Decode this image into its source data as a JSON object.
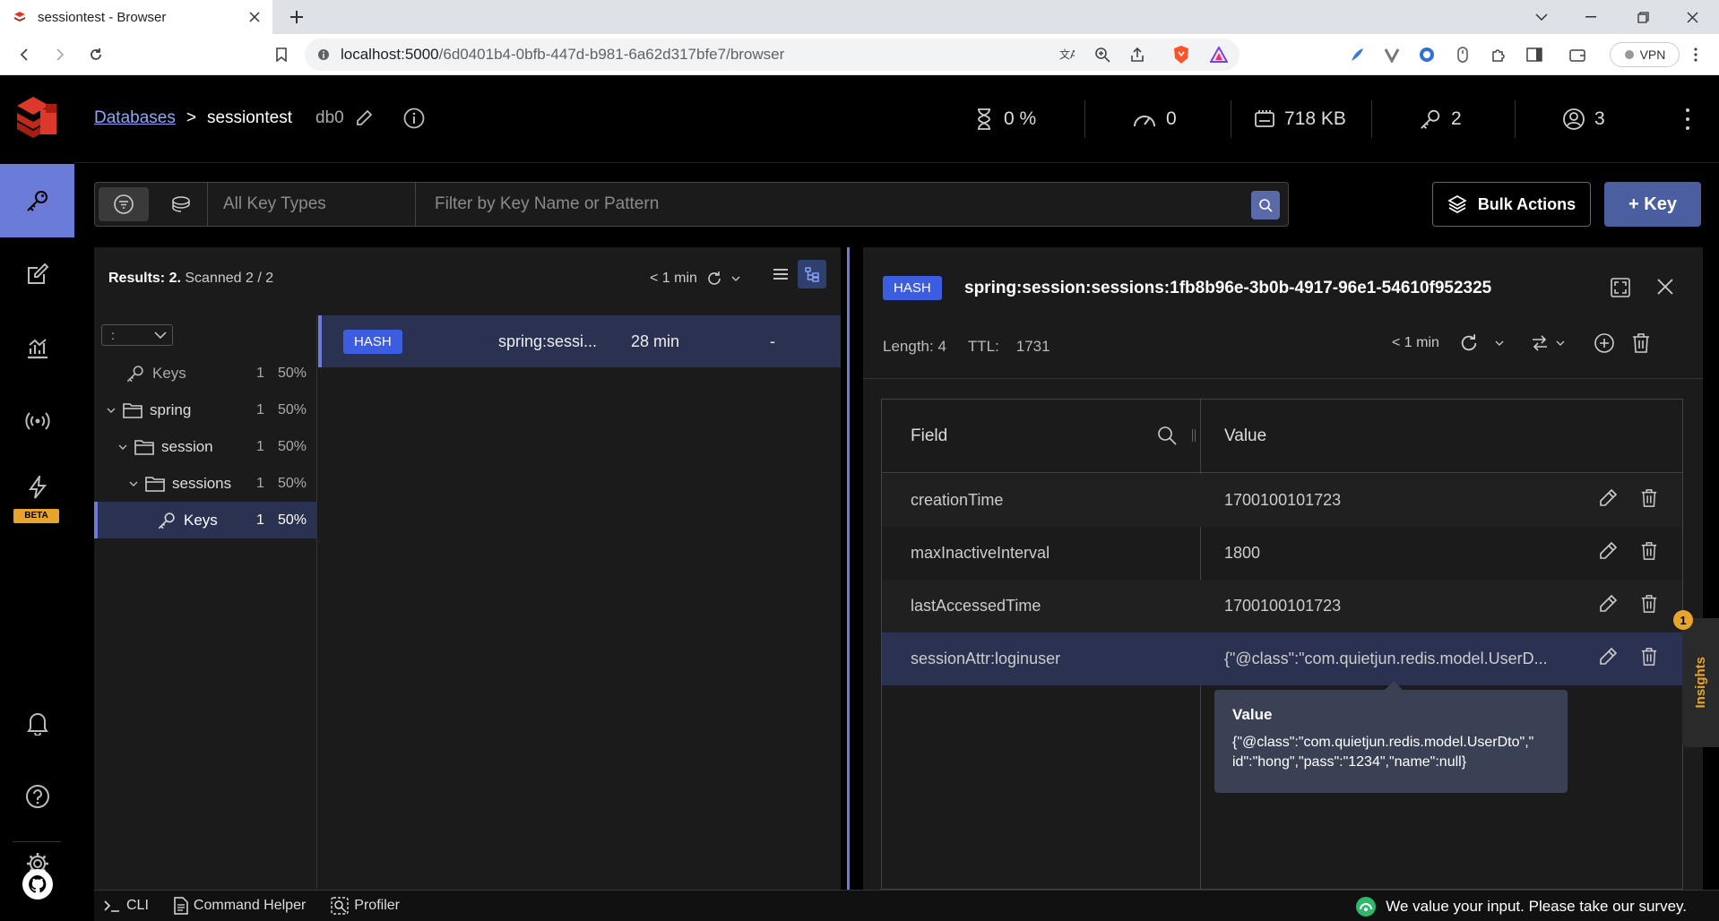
{
  "browser": {
    "tab_title": "sessiontest - Browser",
    "url_host": "localhost:5000",
    "url_path": "/6d0401b4-0bfb-447d-b981-6a62d317bfe7/browser",
    "vpn_label": "VPN"
  },
  "header": {
    "breadcrumb_link": "Databases",
    "breadcrumb_sep": ">",
    "db_name": "sessiontest",
    "db_index": "db0",
    "stats": {
      "cpu": "0 %",
      "ops": "0",
      "memory": "718 KB",
      "keys": "2",
      "clients": "3"
    }
  },
  "filter": {
    "key_type": "All Key Types",
    "placeholder": "Filter by Key Name or Pattern"
  },
  "actions": {
    "bulk": "Bulk Actions",
    "add_key": "+ Key"
  },
  "list": {
    "results_label": "Results: 2.",
    "scanned_label": "Scanned 2 / 2",
    "refresh_label": "< 1 min",
    "delimiter": ":",
    "tree": [
      {
        "label": "Keys",
        "count": "1",
        "pct": "50%"
      },
      {
        "label": "spring",
        "count": "1",
        "pct": "50%"
      },
      {
        "label": "session",
        "count": "1",
        "pct": "50%"
      },
      {
        "label": "sessions",
        "count": "1",
        "pct": "50%"
      },
      {
        "label": "Keys",
        "count": "1",
        "pct": "50%"
      }
    ],
    "keys": [
      {
        "type": "HASH",
        "name": "spring:sessi...",
        "ttl": "28 min",
        "size": "-"
      }
    ]
  },
  "detail": {
    "type": "HASH",
    "key_name": "spring:session:sessions:1fb8b96e-3b0b-4917-96e1-54610f952325",
    "length": "Length: 4",
    "ttl_label": "TTL:",
    "ttl": "1731",
    "refresh_label": "< 1 min",
    "col_field": "Field",
    "col_value": "Value",
    "rows": [
      {
        "field": "creationTime",
        "value": "1700100101723"
      },
      {
        "field": "maxInactiveInterval",
        "value": "1800"
      },
      {
        "field": "lastAccessedTime",
        "value": "1700100101723"
      },
      {
        "field": "sessionAttr:loginuser",
        "value": "{\"@class\":\"com.quietjun.redis.model.UserD..."
      }
    ],
    "tooltip_title": "Value",
    "tooltip_line1": "{\"@class\":\"com.quietjun.redis.model.UserDto\",\"",
    "tooltip_line2": "id\":\"hong\",\"pass\":\"1234\",\"name\":null}"
  },
  "insights": {
    "label": "Insights",
    "badge": "1"
  },
  "sidebar": {
    "beta": "BETA"
  },
  "bottombar": {
    "cli": "CLI",
    "helper": "Command Helper",
    "profiler": "Profiler",
    "survey": "We value your input. Please take our survey."
  },
  "colors": {
    "accent": "#6b7cd8",
    "hash_badge": "#3d5de0",
    "brand_red": "#dc382c",
    "insights": "#e8a52c"
  }
}
